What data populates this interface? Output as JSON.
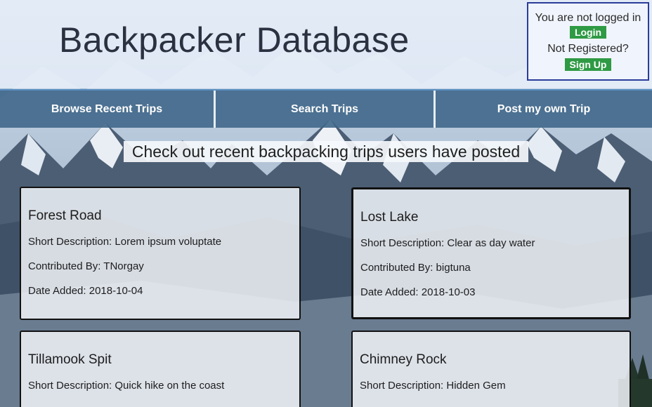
{
  "header": {
    "title": "Backpacker Database"
  },
  "auth": {
    "status": "You are not logged in",
    "login_label": "Login",
    "register_prompt": "Not Registered?",
    "signup_label": "Sign Up"
  },
  "nav": {
    "items": [
      {
        "label": "Browse Recent Trips"
      },
      {
        "label": "Search Trips"
      },
      {
        "label": "Post my own Trip"
      }
    ]
  },
  "main": {
    "heading": "Check out recent backpacking trips users have posted",
    "trips": [
      {
        "title": "Forest Road",
        "description": "Short Description: Lorem ipsum voluptate",
        "contributor": "Contributed By: TNorgay",
        "date": "Date Added: 2018-10-04"
      },
      {
        "title": "Lost Lake",
        "description": "Short Description: Clear as day water",
        "contributor": "Contributed By: bigtuna",
        "date": "Date Added: 2018-10-03"
      },
      {
        "title": "Tillamook Spit",
        "description": "Short Description: Quick hike on the coast"
      },
      {
        "title": "Chimney Rock",
        "description": "Short Description: Hidden Gem"
      }
    ]
  },
  "colors": {
    "nav_bg": "#3c6487",
    "button_green": "#2e9a44",
    "login_border": "#2a3d9a"
  }
}
